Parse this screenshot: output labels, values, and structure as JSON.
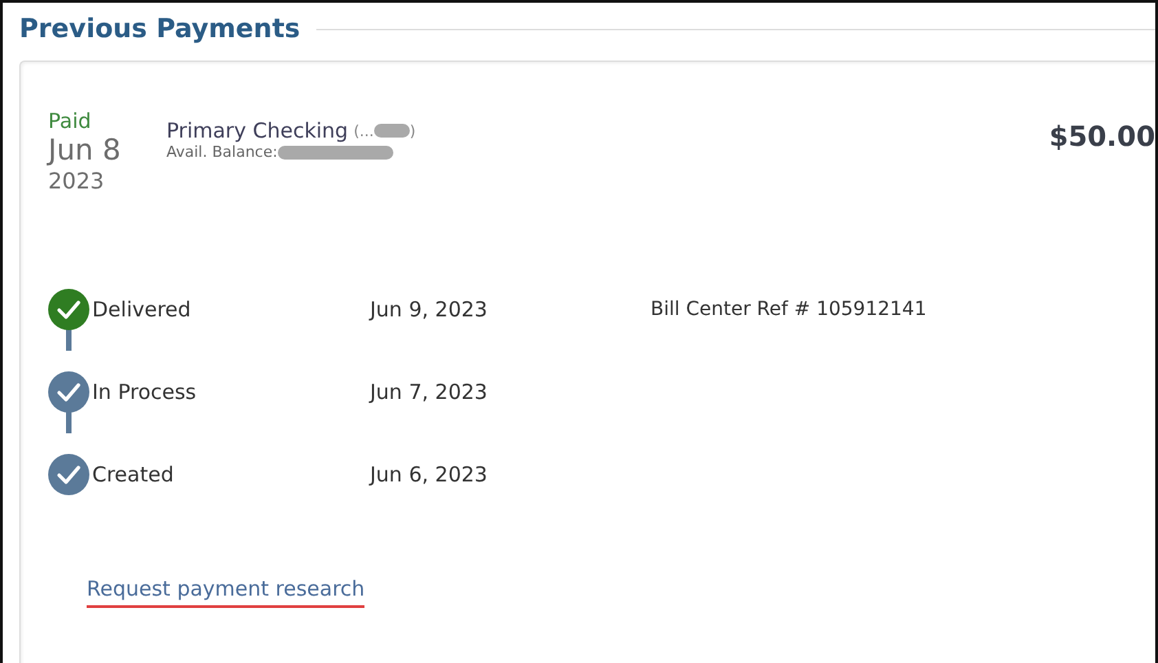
{
  "section": {
    "title": "Previous Payments"
  },
  "payment": {
    "status": "Paid",
    "date": "Jun 8",
    "year": "2023",
    "account": "Primary Checking",
    "mask_open": "(...",
    "mask_close": ")",
    "balance_label": "Avail. Balance:",
    "amount": "$50.00"
  },
  "timeline": [
    {
      "label": "Delivered",
      "date": "Jun 9, 2023",
      "reference": "Bill Center Ref # 105912141",
      "color": "#2f7d22"
    },
    {
      "label": "In Process",
      "date": "Jun 7, 2023",
      "color": "#5b7a99"
    },
    {
      "label": "Created",
      "date": "Jun 6, 2023",
      "color": "#5b7a99"
    }
  ],
  "link": "Request payment research"
}
